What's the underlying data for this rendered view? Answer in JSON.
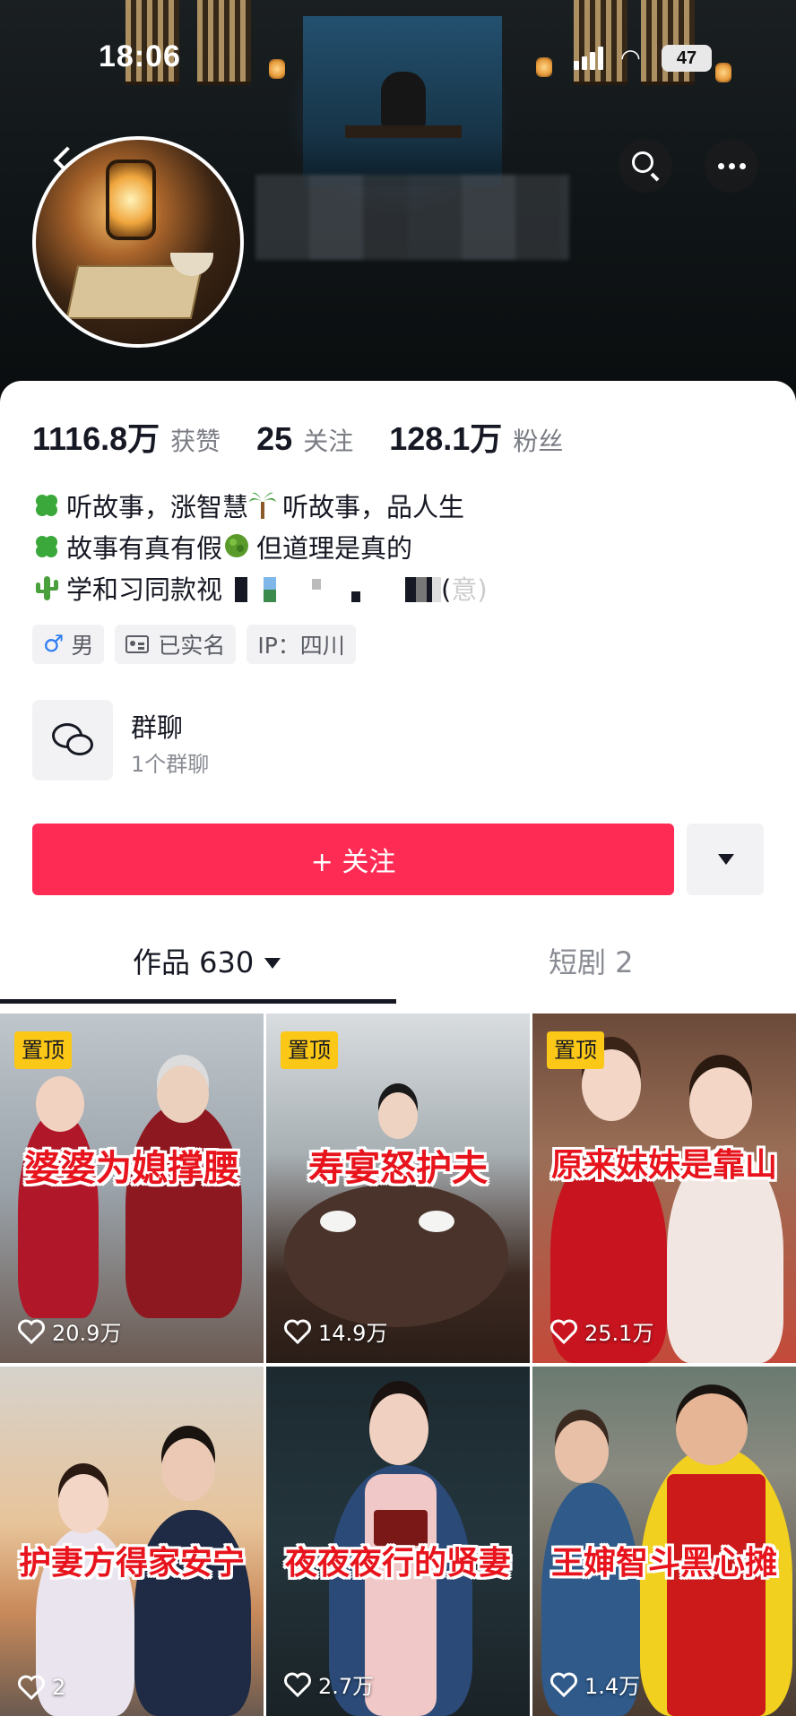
{
  "status_bar": {
    "time": "18:06",
    "battery": "47"
  },
  "stats": [
    {
      "value": "1116.8万",
      "label": "获赞"
    },
    {
      "value": "25",
      "label": "关注"
    },
    {
      "value": "128.1万",
      "label": "粉丝"
    }
  ],
  "bio": {
    "line1_a": "听故事，涨智慧",
    "line1_b": "听故事，品人生",
    "line2_a": "故事有真有假",
    "line2_b": "但道理是真的",
    "line3_a": "学和习同款视",
    "line3_b": "(",
    "line3_c": "意)"
  },
  "tags": {
    "gender": "男",
    "verified": "已实名",
    "ip": "IP：四川"
  },
  "group": {
    "title": "群聊",
    "subtitle": "1个群聊"
  },
  "follow": {
    "label": "+ 关注"
  },
  "tabs": {
    "works": "作品 630",
    "drama": "短剧 2"
  },
  "videos": [
    {
      "pinned": "置顶",
      "caption": "婆婆为媳撑腰",
      "likes": "20.9万"
    },
    {
      "pinned": "置顶",
      "caption": "寿宴怒护夫",
      "likes": "14.9万"
    },
    {
      "pinned": "置顶",
      "caption": "原来妹妹是靠山",
      "likes": "25.1万"
    },
    {
      "pinned": "",
      "caption": "护妻方得家安宁",
      "likes": "2"
    },
    {
      "pinned": "",
      "caption": "夜夜夜行的贤妻",
      "likes": "2.7万"
    },
    {
      "pinned": "",
      "caption": "王婶智斗黑心摊",
      "likes": "1.4万"
    }
  ],
  "colors": {
    "accent": "#fe2c55",
    "pin": "#fbc817",
    "caption": "#e8141d"
  }
}
